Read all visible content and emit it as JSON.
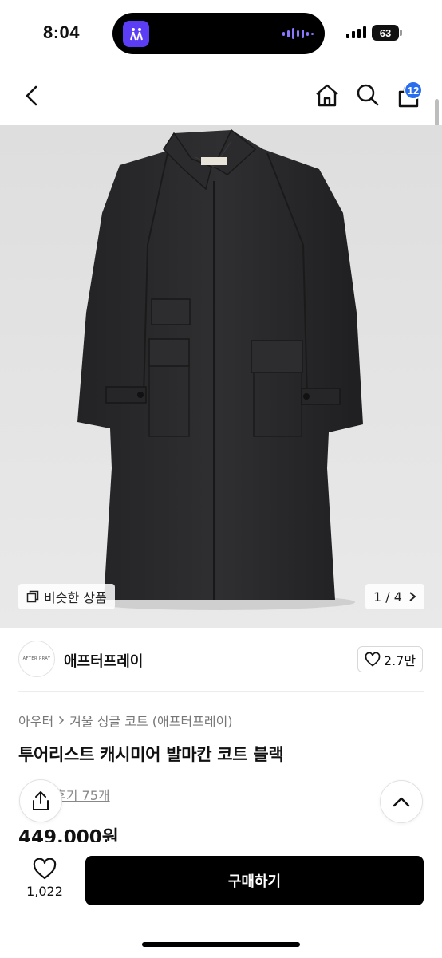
{
  "status_bar": {
    "time": "8:04",
    "battery": "63"
  },
  "header": {
    "cart_count": "12"
  },
  "gallery": {
    "similar_label": "비슷한 상품",
    "pager": "1 / 4"
  },
  "brand": {
    "logo_text": "AFTER PRAY",
    "name": "애프터프레이",
    "likes": "2.7만"
  },
  "product": {
    "breadcrumb": [
      "아우터",
      "겨울 싱글 코트 (애프터프레이)"
    ],
    "title": "투어리스트 캐시미어 발마칸 코트 블랙",
    "reviews": "후기 75개",
    "price": "449,000원"
  },
  "bottom": {
    "wish_count": "1,022",
    "buy_label": "구매하기"
  },
  "colors": {
    "badge": "#2a6ef0",
    "buy_button": "#000000",
    "coat": "#2a2a2c"
  }
}
